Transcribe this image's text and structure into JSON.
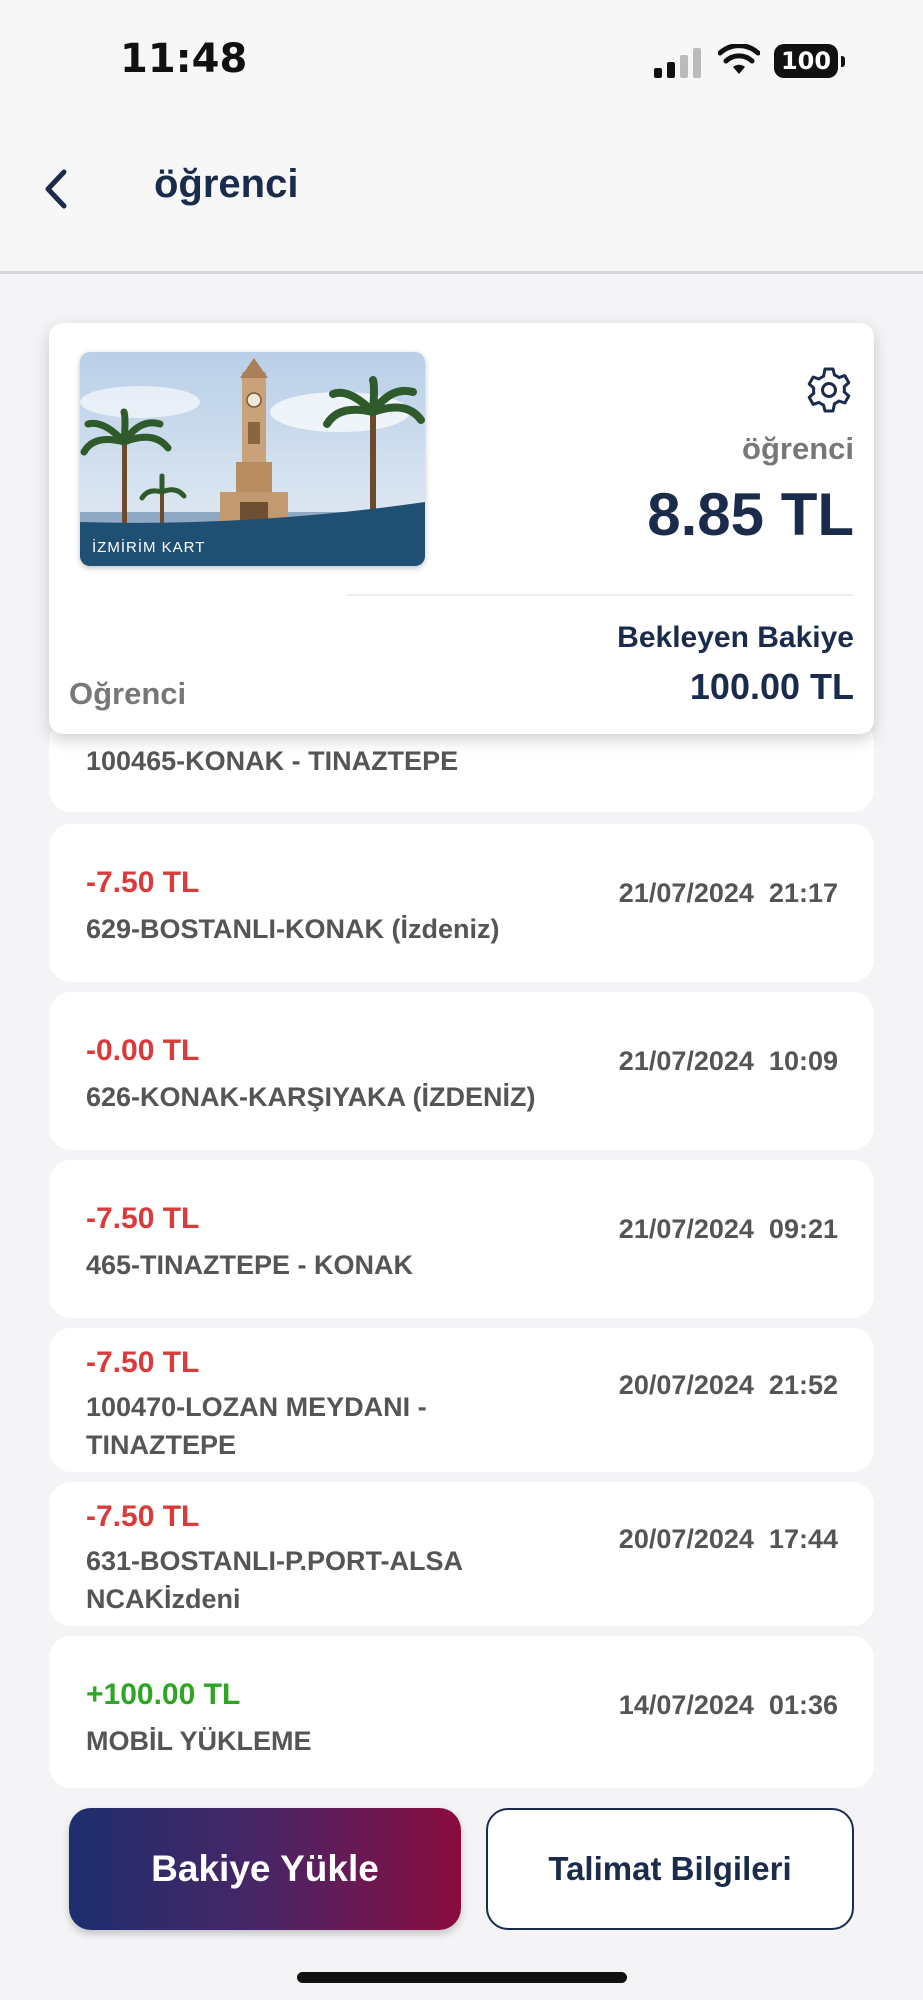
{
  "status_bar": {
    "time": "11:48",
    "battery": "100",
    "icons": [
      "cellular-signal-icon",
      "wifi-icon",
      "battery-icon"
    ]
  },
  "header": {
    "title": "öğrenci",
    "back_icon": "chevron-left-icon"
  },
  "card": {
    "brand_text": "İZMİRİM KART",
    "name_label": "öğrenci",
    "balance": "8.85 TL",
    "pending_label": "Bekleyen Bakiye",
    "pending_value": "100.00 TL",
    "type": "Oğrenci",
    "settings_icon": "gear-icon"
  },
  "transactions": [
    {
      "amount": "",
      "desc": "100465-KONAK - TINAZTEPE",
      "date": ""
    },
    {
      "amount": "-7.50 TL",
      "desc": "629-BOSTANLI-KONAK (İzdeniz)",
      "date": "21/07/2024  21:17"
    },
    {
      "amount": "-0.00 TL",
      "desc": "626-KONAK-KARŞIYAKA (İZDENİZ)",
      "date": "21/07/2024  10:09"
    },
    {
      "amount": "-7.50 TL",
      "desc": "465-TINAZTEPE - KONAK",
      "date": "21/07/2024  09:21"
    },
    {
      "amount": "-7.50 TL",
      "desc": "100470-LOZAN MEYDANI - TINAZTEPE",
      "date": "20/07/2024  21:52"
    },
    {
      "amount": "-7.50 TL",
      "desc": "631-BOSTANLI-P.PORT-ALSANCAKİzdeni",
      "date": "20/07/2024  17:44"
    },
    {
      "amount": "+100.00 TL",
      "desc": "MOBİL YÜKLEME",
      "date": "14/07/2024  01:36"
    }
  ],
  "buttons": {
    "load": "Bakiye Yükle",
    "info": "Talimat Bilgileri"
  },
  "colors": {
    "primary": "#1b2b4b",
    "negative": "#d93a3a",
    "positive": "#2fa524",
    "gradient_start": "#1e2f6e",
    "gradient_end": "#8a0c3e"
  }
}
